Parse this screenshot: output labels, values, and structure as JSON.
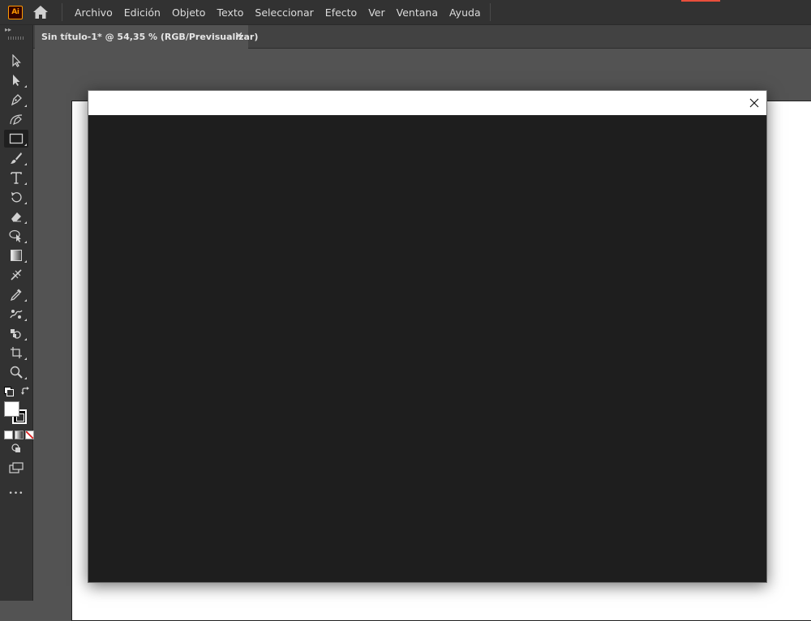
{
  "app": {
    "logo_text": "Ai",
    "logo_color": "#ff9a00",
    "logo_bg": "#330000"
  },
  "menu": {
    "items": [
      "Archivo",
      "Edición",
      "Objeto",
      "Texto",
      "Seleccionar",
      "Efecto",
      "Ver",
      "Ventana",
      "Ayuda"
    ]
  },
  "document_tab": {
    "title": "Sin título-1* @ 54,35 % (RGB/Previsualizar)",
    "close_glyph": "×"
  },
  "toolbar": {
    "tools": [
      "selection-tool-icon",
      "direct-selection-tool-icon",
      "pen-tool-icon",
      "curvature-tool-icon",
      "rectangle-tool-icon",
      "paintbrush-tool-icon",
      "type-tool-icon",
      "rotate-tool-icon",
      "eraser-tool-icon",
      "puppet-warp-tool-icon",
      "gradient-tool-icon",
      "eyedropper-tool-icon",
      "blend-tool-icon",
      "symbol-sprayer-tool-icon",
      "shape-builder-tool-icon",
      "artboard-tool-icon",
      "zoom-tool-icon"
    ],
    "active_tool": "rectangle-tool-icon",
    "more_glyph": "•••"
  },
  "colors": {
    "menubar_bg": "#323232",
    "workspace_bg": "#535353",
    "dialog_bg": "#1e1e1e",
    "artboard_bg": "#ffffff",
    "accent_red": "#e84f3c"
  }
}
